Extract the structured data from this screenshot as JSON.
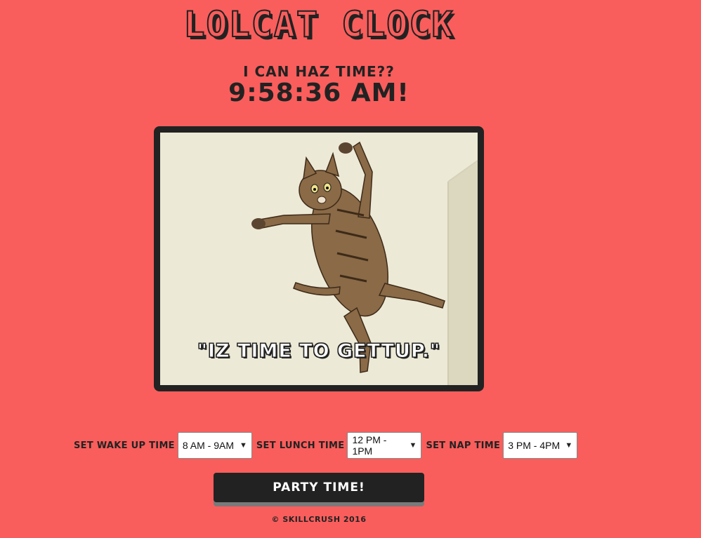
{
  "header": {
    "title": "Lolcat Clock",
    "subtitle": "I can haz time??",
    "clock": "9:58:36 AM!"
  },
  "image": {
    "caption": "\"IZ TIME TO GETTUP.\"",
    "subject": "cat-jumping-icon"
  },
  "controls": {
    "wake_label": "Set wake up time",
    "wake_value": "8 AM - 9AM",
    "lunch_label": "Set lunch time",
    "lunch_value": "12 PM - 1PM",
    "nap_label": "Set nap time",
    "nap_value": "3 PM - 4PM"
  },
  "party_button": "Party Time!",
  "footer": "© SkillCrush 2016",
  "colors": {
    "background": "#f95e5c",
    "dark": "#222222",
    "button_shadow": "#7a7a7a"
  }
}
